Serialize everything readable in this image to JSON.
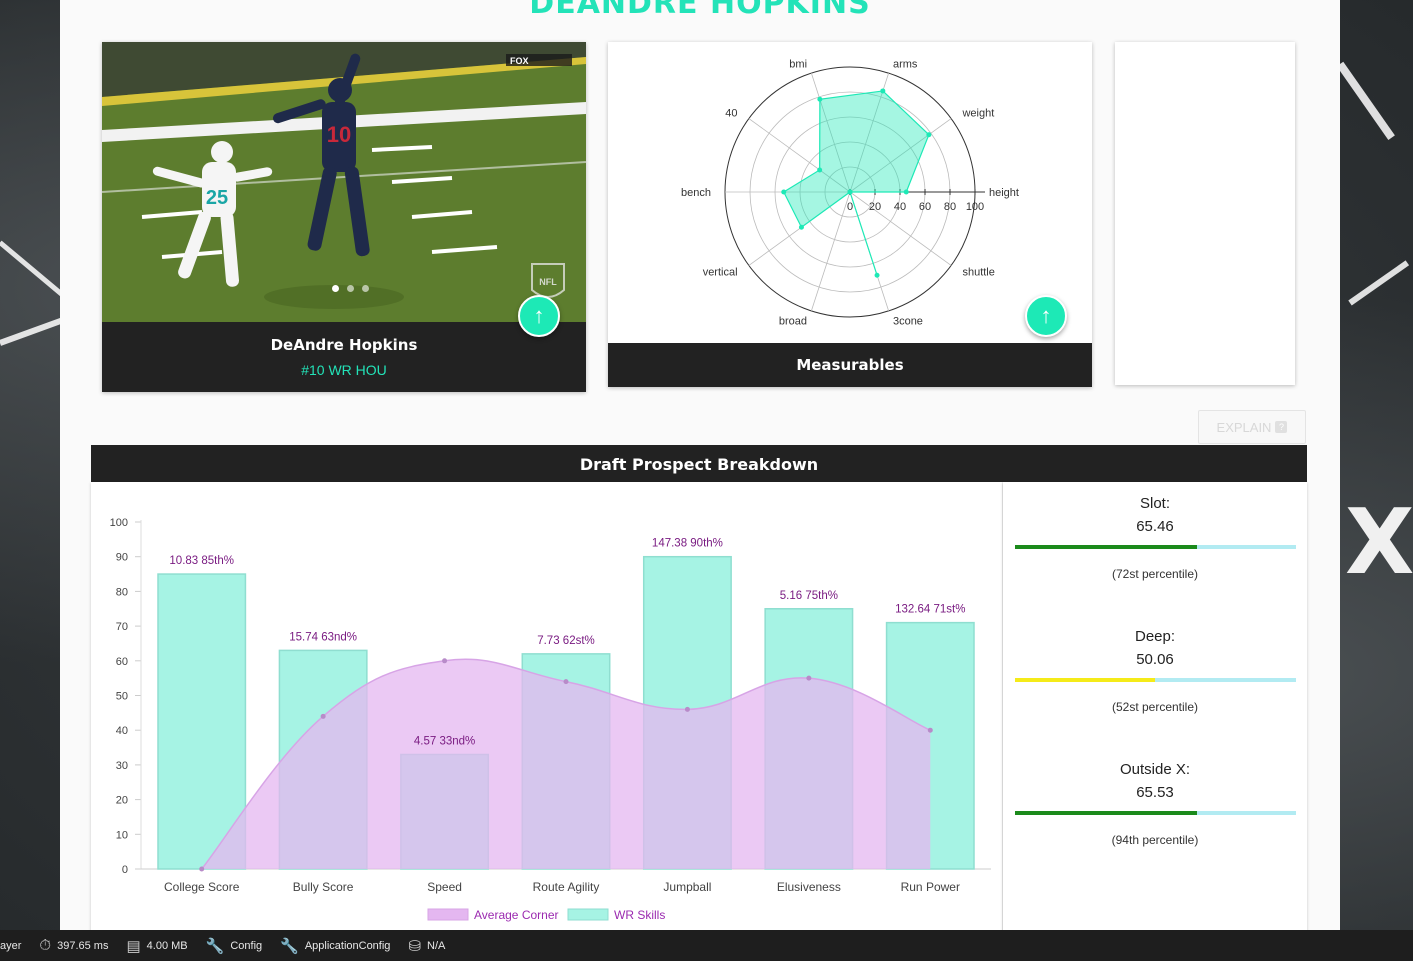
{
  "player": {
    "name": "DEANDRE HOPKINS",
    "full_name": "DeAndre Hopkins",
    "info": "#10 WR HOU"
  },
  "photo": {
    "jersey_number": "10",
    "opponent_number": "25",
    "network_logo": "FOX",
    "league_logo": "NFL",
    "carousel": {
      "count": 3,
      "active": 0
    }
  },
  "measurables": {
    "title": "Measurables",
    "axes": [
      "height",
      "weight",
      "arms",
      "bmi",
      "40",
      "bench",
      "vertical",
      "broad",
      "3cone",
      "shuttle"
    ],
    "values": [
      45,
      78,
      85,
      78,
      30,
      53,
      48,
      0,
      70,
      0
    ],
    "scale_ticks": [
      "0",
      "20",
      "40",
      "60",
      "80",
      "100"
    ],
    "max": 100,
    "color": "#1de9b6"
  },
  "explain": {
    "label": "EXPLAIN",
    "icon": "help-icon"
  },
  "breakdown": {
    "title": "Draft Prospect Breakdown"
  },
  "chart_data": {
    "type": "bar",
    "categories": [
      "College Score",
      "Bully Score",
      "Speed",
      "Route Agility",
      "Jumpball",
      "Elusiveness",
      "Run Power"
    ],
    "series": [
      {
        "name": "WR Skills",
        "type": "bar",
        "values": [
          85,
          63,
          33,
          62,
          90,
          75,
          71
        ],
        "color": "#a6f3e4"
      },
      {
        "name": "Average Corner",
        "type": "area",
        "values": [
          0,
          44,
          60,
          54,
          46,
          55,
          40
        ],
        "color": "#e4b7f0"
      }
    ],
    "data_labels": [
      "10.83 85th%",
      "15.74 63nd%",
      "4.57 33nd%",
      "7.73 62st%",
      "147.38 90th%",
      "5.16 75th%",
      "132.64 71st%"
    ],
    "yticks": [
      "0",
      "10",
      "20",
      "30",
      "40",
      "50",
      "60",
      "70",
      "80",
      "90",
      "100"
    ],
    "ylim": [
      0,
      100
    ],
    "legend": [
      "Average Corner",
      "WR Skills"
    ],
    "legend_position": "bottom"
  },
  "scores": [
    {
      "label": "Slot:",
      "value": "65.46",
      "fill": 0.65,
      "color": "#1b8a1b",
      "percentile": "(72st percentile)"
    },
    {
      "label": "Deep:",
      "value": "50.06",
      "fill": 0.5,
      "color": "#f5eb19",
      "percentile": "(52st percentile)"
    },
    {
      "label": "Outside X:",
      "value": "65.53",
      "fill": 0.65,
      "color": "#1b8a1b",
      "percentile": "(94th percentile)"
    }
  ],
  "devbar": {
    "player_label": "ayer",
    "time": "397.65 ms",
    "memory": "4.00 MB",
    "config": "Config",
    "app_config": "ApplicationConfig",
    "db": "N/A"
  }
}
